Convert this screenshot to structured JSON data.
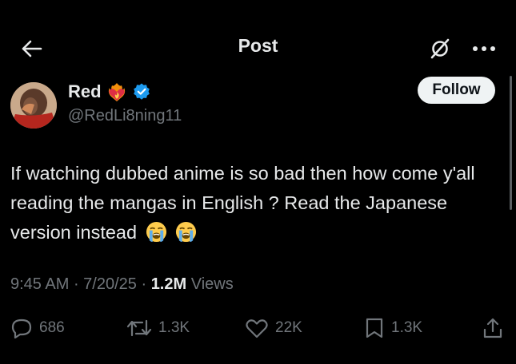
{
  "header": {
    "title": "Post",
    "back_icon": "arrow-left-icon",
    "grok_icon": "grok-icon",
    "more_icon": "more-dots-icon"
  },
  "author": {
    "name": "Red",
    "handle": "@RedLi8ning11",
    "badge_emoji": "heart-on-fire-icon",
    "verified": true,
    "verified_color": "#1d9bf0",
    "follow_label": "Follow"
  },
  "post": {
    "text": "If watching dubbed anime is so bad then how come y'all reading the mangas in English ? Read the Japanese version instead",
    "emojis": [
      "loudly-crying-face-icon",
      "loudly-crying-face-icon"
    ]
  },
  "meta": {
    "time": "9:45 AM",
    "date": "7/20/25",
    "views_count": "1.2M",
    "views_label": "Views"
  },
  "actions": {
    "replies": "686",
    "reposts": "1.3K",
    "likes": "22K",
    "bookmarks": "1.3K",
    "share_icon": "share-icon"
  },
  "colors": {
    "background": "#000000",
    "text": "#e7e9ea",
    "secondary": "#71767b",
    "accent": "#1d9bf0"
  }
}
